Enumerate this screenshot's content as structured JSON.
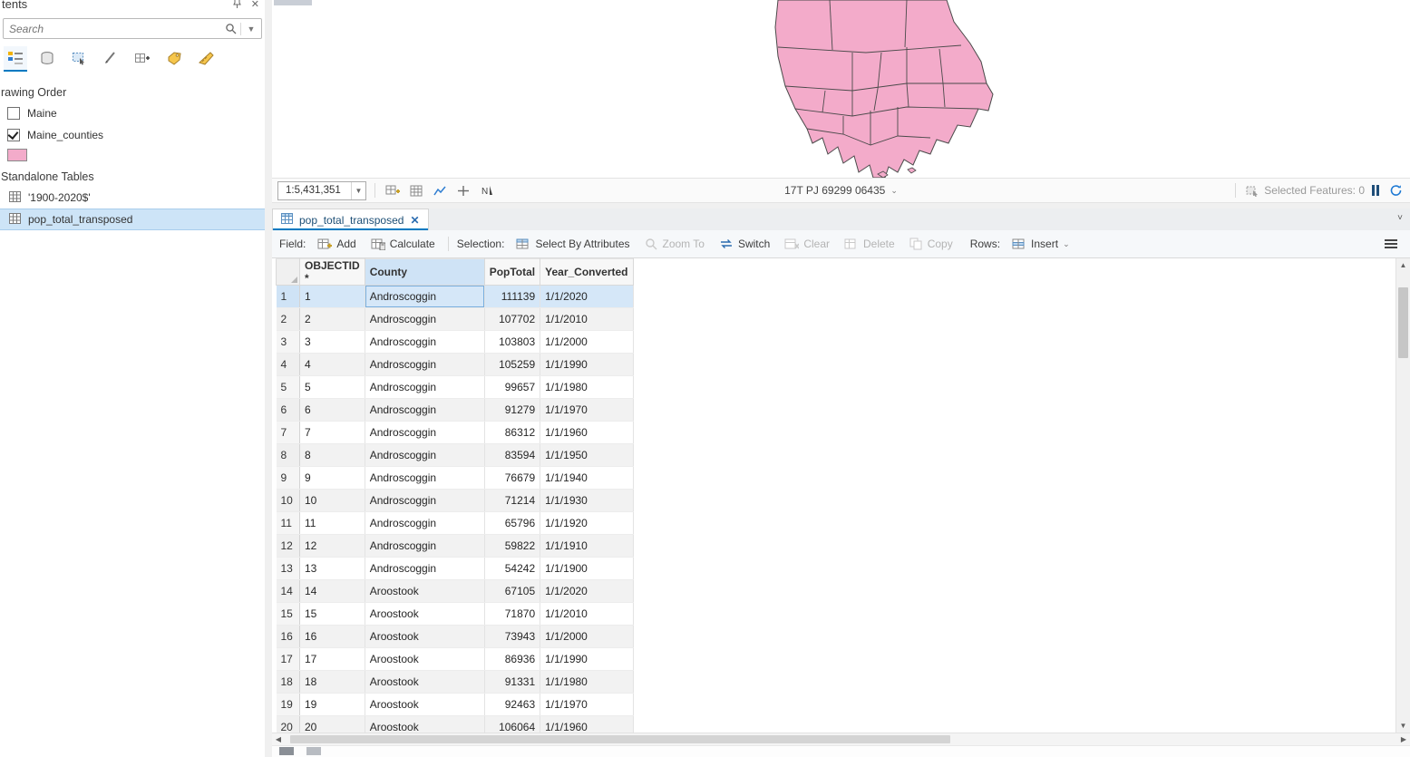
{
  "contents_panel": {
    "title": "tents",
    "search": {
      "placeholder": "Search"
    },
    "drawing_order_label": "rawing Order",
    "layers": [
      {
        "label": "Maine",
        "checked": false
      },
      {
        "label": "Maine_counties",
        "checked": true
      }
    ],
    "legend_swatch_color": "#f3abca",
    "standalone_tables_label": "Standalone Tables",
    "tables": [
      {
        "label": "'1900-2020$'"
      },
      {
        "label": "pop_total_transposed"
      }
    ]
  },
  "map": {
    "scale": "1:5,431,351",
    "coordinates": "17T PJ 69299 06435",
    "selected_features_label": "Selected Features: 0",
    "fill_color": "#f3abca"
  },
  "table_panel": {
    "tab_label": "pop_total_transposed",
    "toolbar": {
      "field_label": "Field:",
      "add_label": "Add",
      "calculate_label": "Calculate",
      "selection_label": "Selection:",
      "select_by_attributes_label": "Select By Attributes",
      "zoom_to_label": "Zoom To",
      "switch_label": "Switch",
      "clear_label": "Clear",
      "delete_label": "Delete",
      "copy_label": "Copy",
      "rows_label": "Rows:",
      "insert_label": "Insert"
    },
    "columns": [
      "OBJECTID *",
      "County",
      "PopTotal",
      "Year_Converted"
    ],
    "selected_row": 1,
    "rows": [
      {
        "num": 1,
        "objectid": "1",
        "county": "Androscoggin",
        "pop": "111139",
        "year": "1/1/2020"
      },
      {
        "num": 2,
        "objectid": "2",
        "county": "Androscoggin",
        "pop": "107702",
        "year": "1/1/2010"
      },
      {
        "num": 3,
        "objectid": "3",
        "county": "Androscoggin",
        "pop": "103803",
        "year": "1/1/2000"
      },
      {
        "num": 4,
        "objectid": "4",
        "county": "Androscoggin",
        "pop": "105259",
        "year": "1/1/1990"
      },
      {
        "num": 5,
        "objectid": "5",
        "county": "Androscoggin",
        "pop": "99657",
        "year": "1/1/1980"
      },
      {
        "num": 6,
        "objectid": "6",
        "county": "Androscoggin",
        "pop": "91279",
        "year": "1/1/1970"
      },
      {
        "num": 7,
        "objectid": "7",
        "county": "Androscoggin",
        "pop": "86312",
        "year": "1/1/1960"
      },
      {
        "num": 8,
        "objectid": "8",
        "county": "Androscoggin",
        "pop": "83594",
        "year": "1/1/1950"
      },
      {
        "num": 9,
        "objectid": "9",
        "county": "Androscoggin",
        "pop": "76679",
        "year": "1/1/1940"
      },
      {
        "num": 10,
        "objectid": "10",
        "county": "Androscoggin",
        "pop": "71214",
        "year": "1/1/1930"
      },
      {
        "num": 11,
        "objectid": "11",
        "county": "Androscoggin",
        "pop": "65796",
        "year": "1/1/1920"
      },
      {
        "num": 12,
        "objectid": "12",
        "county": "Androscoggin",
        "pop": "59822",
        "year": "1/1/1910"
      },
      {
        "num": 13,
        "objectid": "13",
        "county": "Androscoggin",
        "pop": "54242",
        "year": "1/1/1900"
      },
      {
        "num": 14,
        "objectid": "14",
        "county": "Aroostook",
        "pop": "67105",
        "year": "1/1/2020"
      },
      {
        "num": 15,
        "objectid": "15",
        "county": "Aroostook",
        "pop": "71870",
        "year": "1/1/2010"
      },
      {
        "num": 16,
        "objectid": "16",
        "county": "Aroostook",
        "pop": "73943",
        "year": "1/1/2000"
      },
      {
        "num": 17,
        "objectid": "17",
        "county": "Aroostook",
        "pop": "86936",
        "year": "1/1/1990"
      },
      {
        "num": 18,
        "objectid": "18",
        "county": "Aroostook",
        "pop": "91331",
        "year": "1/1/1980"
      },
      {
        "num": 19,
        "objectid": "19",
        "county": "Aroostook",
        "pop": "92463",
        "year": "1/1/1970"
      },
      {
        "num": 20,
        "objectid": "20",
        "county": "Aroostook",
        "pop": "106064",
        "year": "1/1/1960"
      }
    ]
  }
}
